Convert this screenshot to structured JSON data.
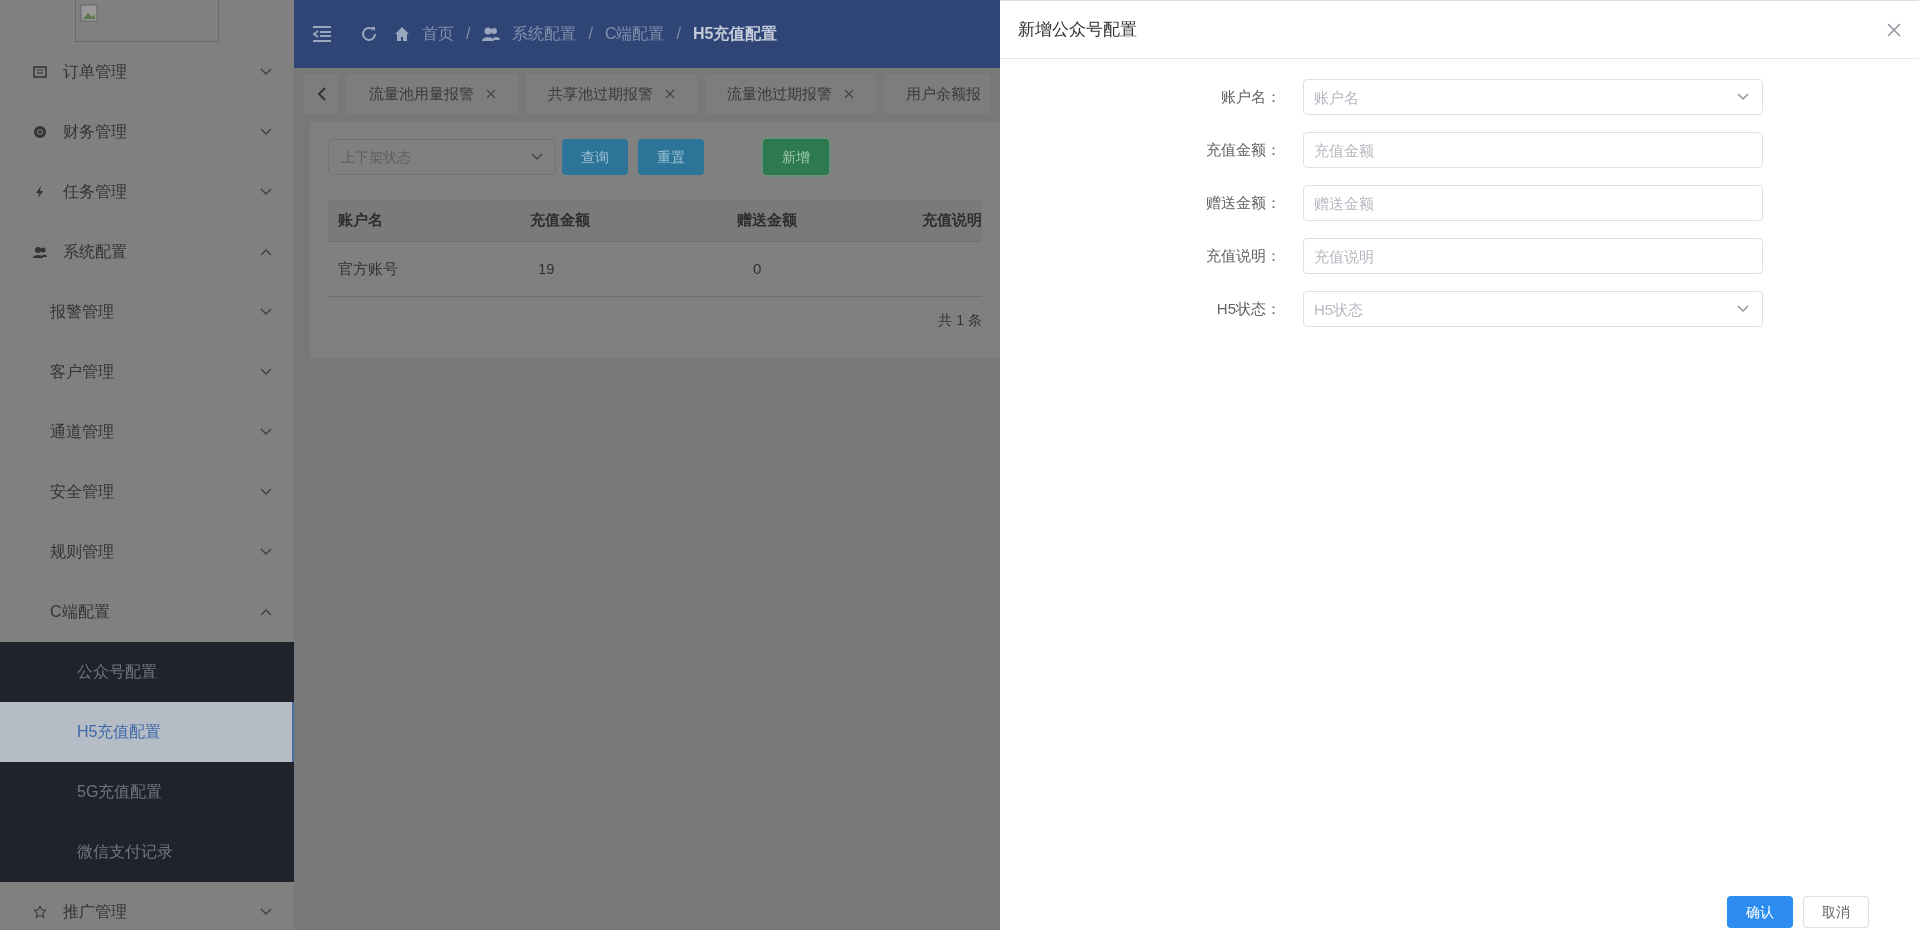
{
  "sidebar": {
    "items": [
      {
        "label": "订单管理",
        "expanded": false
      },
      {
        "label": "财务管理",
        "expanded": false
      },
      {
        "label": "任务管理",
        "expanded": false
      },
      {
        "label": "系统配置",
        "expanded": true,
        "children": [
          {
            "label": "报警管理",
            "expanded": false
          },
          {
            "label": "客户管理",
            "expanded": false
          },
          {
            "label": "通道管理",
            "expanded": false
          },
          {
            "label": "安全管理",
            "expanded": false
          },
          {
            "label": "规则管理",
            "expanded": false
          },
          {
            "label": "C端配置",
            "expanded": true,
            "children": [
              {
                "label": "公众号配置",
                "selected": false
              },
              {
                "label": "H5充值配置",
                "selected": true
              },
              {
                "label": "5G充值配置",
                "selected": false
              },
              {
                "label": "微信支付记录",
                "selected": false
              }
            ]
          }
        ]
      },
      {
        "label": "推广管理",
        "expanded": false
      }
    ]
  },
  "breadcrumb": {
    "items": [
      {
        "label": "首页",
        "current": false
      },
      {
        "label": "系统配置",
        "current": false
      },
      {
        "label": "C端配置",
        "current": false
      },
      {
        "label": "H5充值配置",
        "current": true
      }
    ],
    "separators": [
      "/",
      "/",
      "/"
    ]
  },
  "tabs": [
    {
      "label": "流量池用量报警",
      "closable": true
    },
    {
      "label": "共享池过期报警",
      "closable": true
    },
    {
      "label": "流量池过期报警",
      "closable": true
    },
    {
      "label": "用户余额报",
      "closable": false
    }
  ],
  "filter": {
    "placeholder": "上下架状态"
  },
  "buttons": [
    {
      "label": "查询",
      "kind": "query"
    },
    {
      "label": "重置",
      "kind": "reset"
    },
    {
      "label": "新增",
      "kind": "add"
    }
  ],
  "table": {
    "columns": [
      "账户名",
      "充值金额",
      "赠送金额",
      "充值说明"
    ],
    "rows": [
      [
        "官方账号",
        "19",
        "0"
      ]
    ]
  },
  "pagination": {
    "total": "共 1 条"
  },
  "drawer": {
    "title": "新增公众号配置",
    "fields": [
      {
        "label": "账户名：",
        "placeholder": "账户名",
        "kind": "select"
      },
      {
        "label": "充值金额：",
        "placeholder": "充值金额",
        "kind": "input"
      },
      {
        "label": "赠送金额：",
        "placeholder": "赠送金额",
        "kind": "input"
      },
      {
        "label": "充值说明：",
        "placeholder": "充值说明",
        "kind": "input"
      },
      {
        "label": "H5状态：",
        "placeholder": "H5状态",
        "kind": "select"
      }
    ],
    "buttons": [
      {
        "label": "确认",
        "kind": "primary"
      },
      {
        "label": "取消",
        "kind": "default"
      }
    ]
  }
}
